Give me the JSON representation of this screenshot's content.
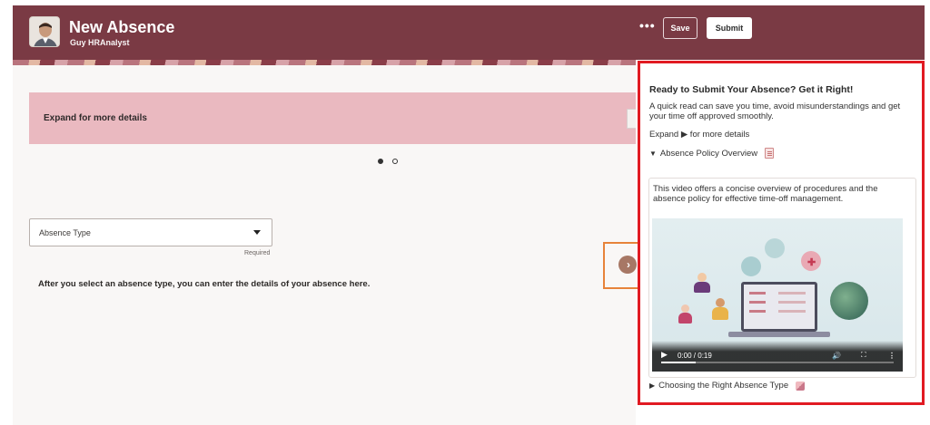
{
  "header": {
    "title": "New Absence",
    "user": "Guy HRAnalyst",
    "more_label": "•••",
    "save_label": "Save",
    "submit_label": "Submit"
  },
  "main": {
    "banner_text": "Expand for more details",
    "pager": {
      "count": 2,
      "active_index": 0
    },
    "absence_type": {
      "label": "Absence Type",
      "required_text": "Required"
    },
    "hint_text": "After you select an absence type, you can enter the details of your absence here."
  },
  "panel": {
    "heading": "Ready to Submit Your Absence? Get it Right!",
    "intro": "A quick read can save you time, avoid misunderstandings and get your time off approved smoothly.",
    "expand_text": "Expand ▶ for more details",
    "policy_toggle": "Absence Policy Overview",
    "video_description": "This video offers a concise overview of procedures and the absence policy for effective time-off management.",
    "video_time": "0:00 / 0:19",
    "choose_toggle": "Choosing the Right Absence Type"
  },
  "colors": {
    "header_bg": "#7a3a44",
    "banner_bg": "#eab9c0",
    "highlight_red": "#e11a22",
    "highlight_orange": "#e7833a"
  }
}
